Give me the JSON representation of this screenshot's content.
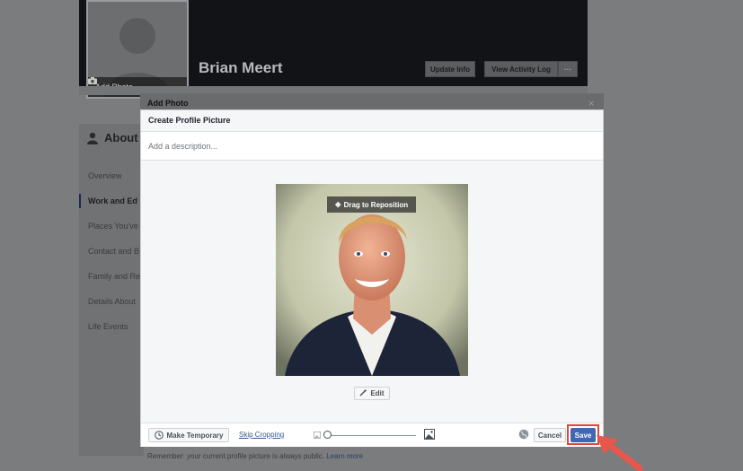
{
  "profile": {
    "name": "Brian Meert",
    "add_photo_label": "Add Photo",
    "update_info_label": "Update Info",
    "view_activity_log_label": "View Activity Log",
    "more_label": "···"
  },
  "about": {
    "heading": "About",
    "items": [
      {
        "label": "Overview"
      },
      {
        "label": "Work and Ed"
      },
      {
        "label": "Places You've"
      },
      {
        "label": "Contact and B"
      },
      {
        "label": "Family and Re"
      },
      {
        "label": "Details About"
      },
      {
        "label": "Life Events"
      }
    ]
  },
  "modal": {
    "title": "Add Photo",
    "subtitle": "Create Profile Picture",
    "description_placeholder": "Add a description...",
    "drag_label": "Drag to Reposition",
    "edit_label": "Edit",
    "make_temporary_label": "Make Temporary",
    "skip_cropping_label": "Skip Cropping",
    "cancel_label": "Cancel",
    "save_label": "Save",
    "zoom_level": 0.0
  },
  "footer_note": {
    "text": "Remember: your current profile picture is always public.",
    "link": "Learn more"
  },
  "colors": {
    "primary": "#4267b2",
    "highlight": "#e2463a",
    "link": "#365899"
  }
}
